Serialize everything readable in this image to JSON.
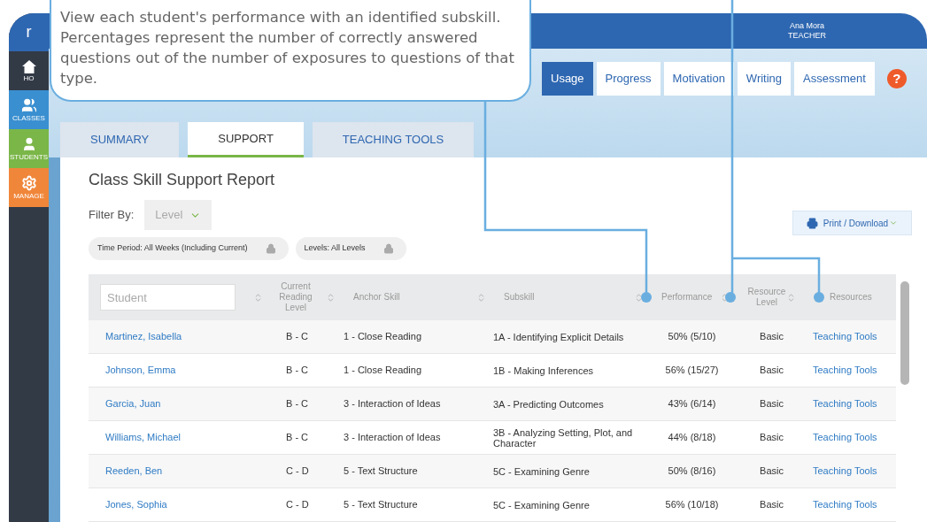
{
  "callout": {
    "text": "View each student's performance with an identified subskill. Percentages represent the number of correctly answered questions out of the number of exposures to questions of that type."
  },
  "logo": "r",
  "sidebar": {
    "items": [
      {
        "label": "HO",
        "kind": "home",
        "color": "#323a46"
      },
      {
        "label": "CLASSES",
        "kind": "classes",
        "color": "#3a8fd0"
      },
      {
        "label": "STUDENTS",
        "kind": "students",
        "color": "#7ab648"
      },
      {
        "label": "MANAGE",
        "kind": "manage",
        "color": "#f0863a"
      }
    ]
  },
  "header": {
    "user_name": "Ana Mora",
    "user_role": "TEACHER"
  },
  "top_tabs": [
    {
      "label": "Usage",
      "selected": true
    },
    {
      "label": "Progress",
      "selected": false
    },
    {
      "label": "Motivation",
      "selected": false
    },
    {
      "label": "Writing",
      "selected": false
    },
    {
      "label": "Assessment",
      "selected": false
    }
  ],
  "help_button": "?",
  "sub_tabs": [
    {
      "label": "SUMMARY",
      "selected": false
    },
    {
      "label": "SUPPORT",
      "selected": true
    },
    {
      "label": "TEACHING TOOLS",
      "selected": false
    }
  ],
  "report": {
    "title": "Class Skill Support Report",
    "filter_label": "Filter By:",
    "filter_value": "Level",
    "chips": [
      "Time Period: All Weeks (Including Current)",
      "Levels: All Levels"
    ],
    "print_button": "Print / Download"
  },
  "table": {
    "columns": [
      {
        "kind": "search",
        "placeholder": "Student",
        "sortable": true
      },
      {
        "label": "Current Reading Level",
        "kind": "text",
        "sortable": true
      },
      {
        "label": "Anchor Skill",
        "kind": "text",
        "sortable": true
      },
      {
        "label": "Subskill",
        "kind": "text",
        "sortable": true
      },
      {
        "label": "Performance",
        "kind": "text",
        "sortable": true
      },
      {
        "label": "Resource Level",
        "kind": "text",
        "sortable": true
      },
      {
        "label": "Resources",
        "kind": "text",
        "sortable": false
      }
    ],
    "rows": [
      {
        "student": "Martinez, Isabella",
        "level": "B - C",
        "anchor_skill": "1 - Close Reading",
        "subskill": "1A - Identifying Explicit Details",
        "performance": "50% (5/10)",
        "resource_level": "Basic",
        "resources": "Teaching Tools"
      },
      {
        "student": "Johnson, Emma",
        "level": "B - C",
        "anchor_skill": "1 - Close Reading",
        "subskill": "1B - Making Inferences",
        "performance": "56% (15/27)",
        "resource_level": "Basic",
        "resources": "Teaching Tools"
      },
      {
        "student": "Garcia, Juan",
        "level": "B - C",
        "anchor_skill": "3 - Interaction of Ideas",
        "subskill": "3A - Predicting Outcomes",
        "performance": "43% (6/14)",
        "resource_level": "Basic",
        "resources": "Teaching Tools"
      },
      {
        "student": "Williams, Michael",
        "level": "B - C",
        "anchor_skill": "3 - Interaction of Ideas",
        "subskill": "3B - Analyzing Setting, Plot, and Character",
        "performance": "44% (8/18)",
        "resource_level": "Basic",
        "resources": "Teaching Tools"
      },
      {
        "student": "Reeden, Ben",
        "level": "C - D",
        "anchor_skill": "5 - Text Structure",
        "subskill": "5C - Examining Genre",
        "performance": "50% (8/16)",
        "resource_level": "Basic",
        "resources": "Teaching Tools"
      },
      {
        "student": "Jones, Sophia",
        "level": "C - D",
        "anchor_skill": "5 - Text Structure",
        "subskill": "5C - Examining Genre",
        "performance": "56% (10/18)",
        "resource_level": "Basic",
        "resources": "Teaching Tools"
      }
    ]
  }
}
